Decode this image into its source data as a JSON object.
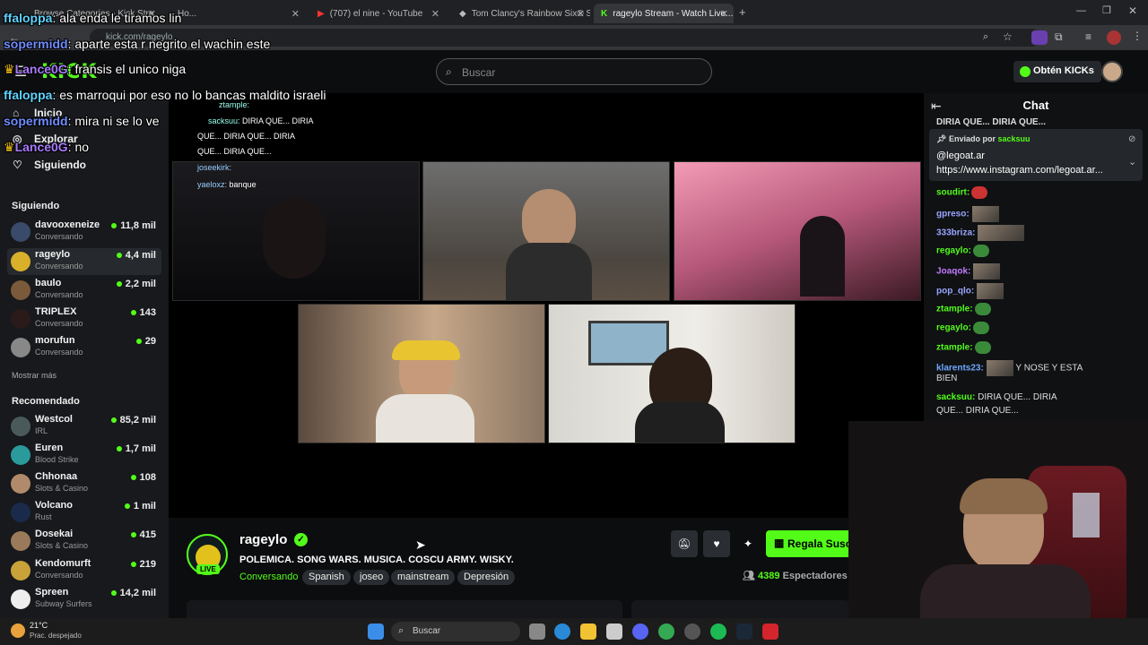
{
  "browser": {
    "tabs": [
      {
        "label": "Browse Categories - Kick Stre..."
      },
      {
        "label": "Ho..."
      },
      {
        "label": "(707) el nine - YouTube"
      },
      {
        "label": "Tom Clancy's Rainbow Six® Sie..."
      },
      {
        "label": "rageylo Stream - Watch Live..."
      }
    ],
    "url": "kick.com/rageylo"
  },
  "header": {
    "logo": "KICK",
    "search_placeholder": "Buscar",
    "kicks_button": "Obtén KICKs"
  },
  "sidebar": {
    "nav": [
      {
        "label": "Inicio",
        "icon": "home-icon"
      },
      {
        "label": "Explorar",
        "icon": "compass-icon"
      },
      {
        "label": "Siguiendo",
        "icon": "heart-icon"
      }
    ],
    "following_title": "Siguiendo",
    "following": [
      {
        "name": "davooxeneize",
        "sub": "Conversando",
        "viewers": "11,8 mil"
      },
      {
        "name": "rageylo",
        "sub": "Conversando",
        "viewers": "4,4 mil"
      },
      {
        "name": "baulo",
        "sub": "Conversando",
        "viewers": "2,2 mil"
      },
      {
        "name": "TRIPLEX",
        "sub": "Conversando",
        "viewers": "143"
      },
      {
        "name": "morufun",
        "sub": "Conversando",
        "viewers": "29"
      }
    ],
    "show_more": "Mostrar más",
    "recommended_title": "Recomendado",
    "recommended": [
      {
        "name": "Westcol",
        "sub": "IRL",
        "viewers": "85,2 mil"
      },
      {
        "name": "Euren",
        "sub": "Blood Strike",
        "viewers": "1,7 mil"
      },
      {
        "name": "Chhonaa",
        "sub": "Slots & Casino",
        "viewers": "108"
      },
      {
        "name": "Volcano",
        "sub": "Rust",
        "viewers": "1 mil"
      },
      {
        "name": "Dosekai",
        "sub": "Slots & Casino",
        "viewers": "415"
      },
      {
        "name": "Kendomurft",
        "sub": "Conversando",
        "viewers": "219"
      },
      {
        "name": "Spreen",
        "sub": "Subway Surfers",
        "viewers": "14,2 mil"
      }
    ]
  },
  "overlay_chat": [
    {
      "user": "ffaloppa",
      "text": ": ala enda le tiramos lin",
      "color": "#5fd3ff"
    },
    {
      "user": "sopermidd",
      "text": ": aparte esta r negrito el wachin este",
      "color": "#6f8cff"
    },
    {
      "user": "Lance0G",
      "text": ": fransis el unico niga",
      "color": "#a97bff"
    },
    {
      "user": "ffaloppa",
      "text": ": es marroqui por eso no lo bancas maldito israeli",
      "color": "#5fd3ff"
    },
    {
      "user": "sopermidd",
      "text": ": mira ni se lo ve",
      "color": "#6f8cff"
    },
    {
      "user": "Lance0G",
      "text": ": no",
      "color": "#a97bff"
    }
  ],
  "video_inner_chat": [
    {
      "user": "ztample:",
      "text": ""
    },
    {
      "user": "sacksuu:",
      "text": "DIRIA QUE... DIRIA"
    },
    {
      "user": "",
      "text": "QUE... DIRIA QUE... DIRIA"
    },
    {
      "user": "",
      "text": "QUE... DIRIA QUE..."
    },
    {
      "user": "joseekirk:",
      "text": ""
    },
    {
      "user": "yaeloxz:",
      "text": "banque"
    }
  ],
  "stream": {
    "streamer": "rageylo",
    "live_badge": "LIVE",
    "title": "POLEMICA. SONG WARS. MUSICA. COSCU ARMY. WISKY.",
    "category": "Conversando",
    "tags": [
      "Spanish",
      "joseo",
      "mainstream",
      "Depresión"
    ],
    "subscribe_label": "Regala Suscr",
    "viewers": "4389",
    "viewers_label": "Espectadores"
  },
  "chat": {
    "title": "Chat",
    "top_line": "DIRIA QUE...          DIRIA QUE...",
    "pinned_by_label": "Enviado por",
    "pinned_by_user": "sacksuu",
    "pinned_line1": "@legoat.ar",
    "pinned_line2": "https://www.instagram.com/legoat.ar...",
    "messages": [
      {
        "user": "soudirt:",
        "text": "",
        "color": "#53fc18"
      },
      {
        "user": "gpreso:",
        "text": "",
        "color": "#9aa6ff"
      },
      {
        "user": "333briza:",
        "text": "",
        "color": "#9aa6ff"
      },
      {
        "user": "regaylo:",
        "text": "",
        "color": "#53fc18"
      },
      {
        "user": "Joaqok:",
        "text": "",
        "color": "#c27bff"
      },
      {
        "user": "pop_qlo:",
        "text": "",
        "color": "#9aa6ff"
      },
      {
        "user": "ztample:",
        "text": "",
        "color": "#53fc18"
      },
      {
        "user": "regaylo:",
        "text": "",
        "color": "#53fc18"
      },
      {
        "user": "ztample:",
        "text": "",
        "color": "#53fc18"
      },
      {
        "user": "klarents23:",
        "text": "Y NOSE Y ESTA",
        "color": "#6fa8ff"
      },
      {
        "user": "",
        "text": "BIEN",
        "color": "#ddd"
      },
      {
        "user": "sacksuu:",
        "text": "DIRIA QUE...      DIRIA",
        "color": "#53fc18"
      },
      {
        "user": "",
        "text": "QUE...       DIRIA QUE...",
        "color": "#ddd"
      }
    ]
  },
  "taskbar": {
    "weather_temp": "21°C",
    "weather_desc": "Prac. despejado",
    "search_placeholder": "Buscar"
  },
  "colors": {
    "accent": "#53fc18",
    "bg": "#0b0d0e"
  }
}
